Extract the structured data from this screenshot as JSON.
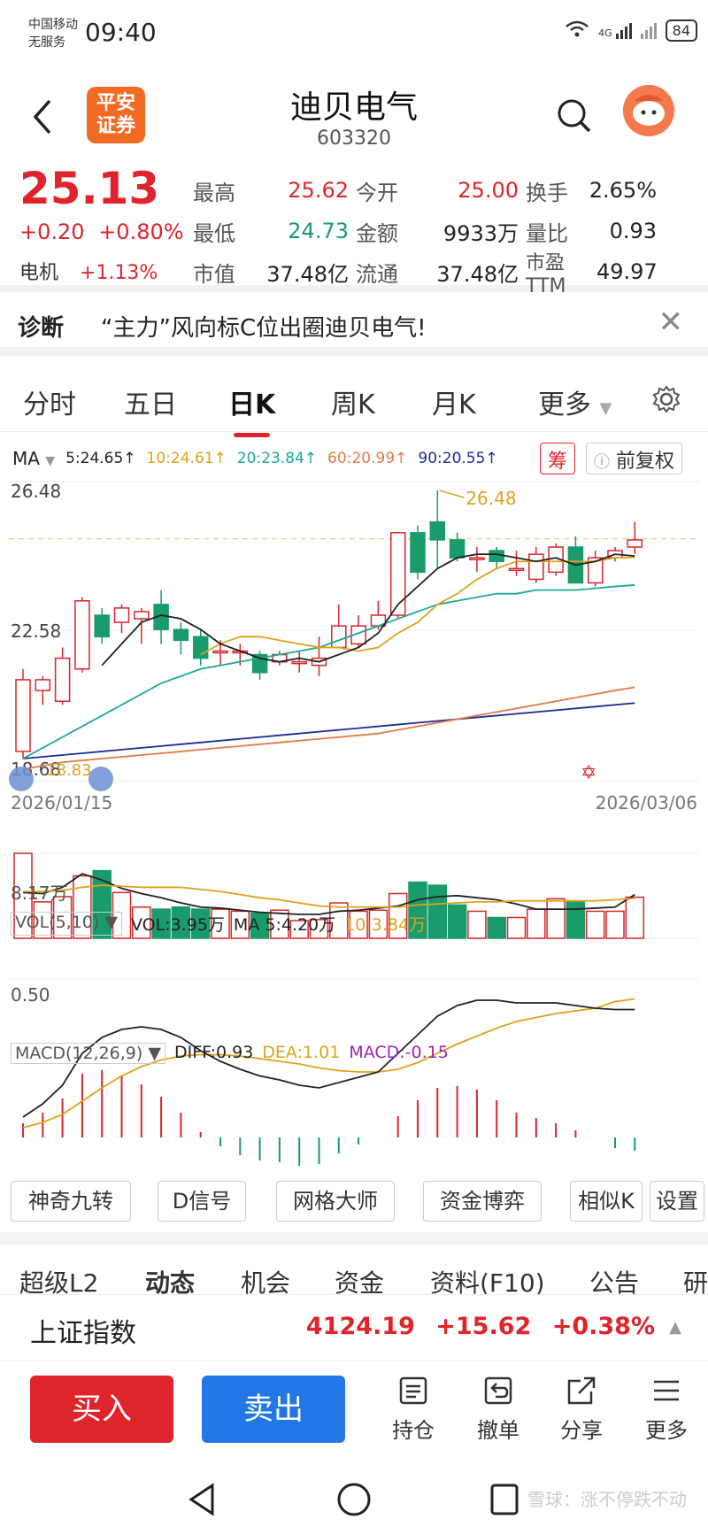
{
  "status": {
    "carrier1": "中国移动",
    "carrier2": "无服务",
    "time": "09:40",
    "network": "4G",
    "battery": "84"
  },
  "header": {
    "logo_line1": "平安",
    "logo_line2": "证券",
    "title": "迪贝电气",
    "code": "603320"
  },
  "quote": {
    "price": "25.13",
    "change": "+0.20",
    "change_pct": "+0.80%",
    "sector_name": "电机",
    "sector_pct": "+1.13%",
    "rows": [
      [
        {
          "l": "最高",
          "v": "25.62",
          "c": "red"
        },
        {
          "l": "今开",
          "v": "25.00",
          "c": "red"
        },
        {
          "l": "换手",
          "v": "2.65%",
          "c": ""
        }
      ],
      [
        {
          "l": "最低",
          "v": "24.73",
          "c": "green"
        },
        {
          "l": "金额",
          "v": "9933万",
          "c": ""
        },
        {
          "l": "量比",
          "v": "0.93",
          "c": ""
        }
      ],
      [
        {
          "l": "市值",
          "v": "37.48亿",
          "c": ""
        },
        {
          "l": "流通",
          "v": "37.48亿",
          "c": ""
        },
        {
          "l": "市盈TTM",
          "v": "49.97",
          "c": ""
        }
      ]
    ]
  },
  "diagnosis": {
    "label": "诊断",
    "text": "“主力”风向标C位出圈迪贝电气!"
  },
  "tabs": [
    "分时",
    "五日",
    "日K",
    "周K",
    "月K",
    "更多"
  ],
  "ma_legend": {
    "label": "MA",
    "ma5": "5:24.65↑",
    "ma10": "10:24.61↑",
    "ma20": "20:23.84↑",
    "ma60": "60:20.99↑",
    "ma90": "90:20.55↑",
    "chip": "筹",
    "fq": "前复权"
  },
  "axis": {
    "top": "26.48",
    "mid": "22.58",
    "low": "18.68",
    "low_annot": "18.83",
    "high_annot": "26.48",
    "date_start": "2026/01/15",
    "date_end": "2026/03/06"
  },
  "vol_legend": {
    "label": "VOL(5,10)",
    "vol": "VOL:3.95万",
    "ma5": "MA 5:4.20万",
    "ma10": "10:3.84万",
    "axis_label": "8.17万"
  },
  "macd_legend": {
    "label": "MACD(12,26,9)",
    "diff": "DIFF:0.93",
    "dea": "DEA:1.01",
    "macd": "MACD:-0.15",
    "axis_label": "0.50"
  },
  "tools": [
    "神奇九转",
    "D信号",
    "网格大师",
    "资金博弈",
    "相似K",
    "设置"
  ],
  "subtabs": [
    "超级L2",
    "动态",
    "机会",
    "资金",
    "资料(F10)",
    "公告",
    "研"
  ],
  "index": {
    "name": "上证指数",
    "value": "4124.19",
    "change": "+15.62",
    "pct": "+0.38%"
  },
  "actions": {
    "buy": "买入",
    "sell": "卖出",
    "hold": "持仓",
    "cancel": "撤单",
    "share": "分享",
    "more": "更多"
  },
  "watermark": "雪球：涨不停跌不动",
  "chart_data": {
    "type": "candlestick",
    "x": [
      "2026/01/15",
      "2026/03/06"
    ],
    "ylim": [
      18.68,
      26.48
    ],
    "candles": [
      [
        19.2,
        21.2,
        19.0,
        21.5
      ],
      [
        20.9,
        21.2,
        20.5,
        21.3
      ],
      [
        20.6,
        21.8,
        20.5,
        22.1
      ],
      [
        21.5,
        23.4,
        21.4,
        23.5
      ],
      [
        23.0,
        22.4,
        22.2,
        23.2
      ],
      [
        22.8,
        23.2,
        22.5,
        23.3
      ],
      [
        22.9,
        23.1,
        22.2,
        23.2
      ],
      [
        23.3,
        22.6,
        22.2,
        23.7
      ],
      [
        22.6,
        22.3,
        21.9,
        22.8
      ],
      [
        22.4,
        21.8,
        21.6,
        22.6
      ],
      [
        22.0,
        22.0,
        21.6,
        22.3
      ],
      [
        22.0,
        22.0,
        21.6,
        22.2
      ],
      [
        21.9,
        21.4,
        21.2,
        22.0
      ],
      [
        21.7,
        21.9,
        21.6,
        22.0
      ],
      [
        21.7,
        21.7,
        21.4,
        22.0
      ],
      [
        21.6,
        21.8,
        21.3,
        22.4
      ],
      [
        22.1,
        22.7,
        22.1,
        23.3
      ],
      [
        22.2,
        22.7,
        22.1,
        23.0
      ],
      [
        22.7,
        23.0,
        22.6,
        23.4
      ],
      [
        23.0,
        25.3,
        22.9,
        25.3
      ],
      [
        25.3,
        24.2,
        24.0,
        25.5
      ],
      [
        25.6,
        25.1,
        24.3,
        26.48
      ],
      [
        25.1,
        24.6,
        24.5,
        25.3
      ],
      [
        24.6,
        24.6,
        24.2,
        24.9
      ],
      [
        24.8,
        24.5,
        24.3,
        24.9
      ],
      [
        24.3,
        24.3,
        24.1,
        24.8
      ],
      [
        24.0,
        24.7,
        23.9,
        24.9
      ],
      [
        24.2,
        24.9,
        24.1,
        25.0
      ],
      [
        24.9,
        23.9,
        23.9,
        25.2
      ],
      [
        23.9,
        24.6,
        23.8,
        24.8
      ],
      [
        24.6,
        24.8,
        24.5,
        24.9
      ],
      [
        24.9,
        25.1,
        24.7,
        25.6
      ]
    ],
    "ma5": [
      null,
      null,
      null,
      null,
      21.6,
      22.2,
      22.8,
      23.0,
      22.9,
      22.6,
      22.2,
      22.0,
      21.8,
      21.7,
      21.8,
      21.7,
      21.9,
      22.1,
      22.5,
      23.3,
      23.8,
      24.3,
      24.6,
      24.7,
      24.7,
      24.6,
      24.5,
      24.6,
      24.4,
      24.5,
      24.7,
      24.65
    ],
    "ma10": [
      null,
      null,
      null,
      null,
      null,
      null,
      null,
      null,
      null,
      21.9,
      22.2,
      22.4,
      22.4,
      22.3,
      22.2,
      22.1,
      22.1,
      22.0,
      22.1,
      22.5,
      22.8,
      23.3,
      23.6,
      24.0,
      24.3,
      24.5,
      24.5,
      24.5,
      24.5,
      24.5,
      24.6,
      24.61
    ],
    "ma20": [
      19.0,
      19.3,
      19.6,
      19.9,
      20.2,
      20.5,
      20.8,
      21.1,
      21.3,
      21.5,
      21.6,
      21.7,
      21.8,
      21.9,
      22.0,
      22.1,
      22.3,
      22.5,
      22.7,
      22.9,
      23.1,
      23.3,
      23.4,
      23.5,
      23.6,
      23.6,
      23.7,
      23.7,
      23.7,
      23.75,
      23.8,
      23.84
    ],
    "ma60": [
      18.7,
      18.8,
      18.9,
      18.95,
      19.0,
      19.05,
      19.1,
      19.15,
      19.2,
      19.25,
      19.3,
      19.35,
      19.4,
      19.45,
      19.5,
      19.55,
      19.6,
      19.65,
      19.7,
      19.8,
      19.9,
      20.0,
      20.1,
      20.2,
      20.3,
      20.4,
      20.5,
      20.6,
      20.7,
      20.8,
      20.9,
      20.99
    ],
    "ma90": [
      19.0,
      19.05,
      19.1,
      19.15,
      19.2,
      19.25,
      19.3,
      19.35,
      19.4,
      19.45,
      19.5,
      19.55,
      19.6,
      19.65,
      19.7,
      19.75,
      19.8,
      19.85,
      19.9,
      19.95,
      20.0,
      20.05,
      20.1,
      20.15,
      20.2,
      20.25,
      20.3,
      20.35,
      20.4,
      20.45,
      20.5,
      20.55
    ],
    "volume": [
      8.17,
      3.5,
      4.0,
      6.0,
      6.5,
      4.4,
      3.0,
      2.8,
      3.0,
      2.8,
      2.8,
      2.6,
      2.4,
      2.7,
      1.7,
      1.8,
      3.4,
      2.6,
      2.7,
      4.3,
      5.4,
      5.1,
      3.2,
      2.6,
      2.0,
      2.0,
      2.8,
      3.8,
      3.5,
      2.6,
      2.6,
      3.95
    ],
    "vol_ma5": [
      4.4,
      4.3,
      4.9,
      6.2,
      5.6,
      4.8,
      4.3,
      3.9,
      3.4,
      3.0,
      2.9,
      2.7,
      2.5,
      2.4,
      2.3,
      2.3,
      2.6,
      2.7,
      2.9,
      3.1,
      3.7,
      4.0,
      4.1,
      3.9,
      3.7,
      3.3,
      2.8,
      2.8,
      2.8,
      2.9,
      3.0,
      4.2
    ],
    "vol_ma10": [
      4.5,
      4.5,
      4.6,
      4.9,
      5.1,
      5.0,
      4.9,
      4.9,
      4.9,
      4.7,
      4.5,
      4.2,
      3.9,
      3.7,
      3.4,
      3.1,
      3.0,
      3.0,
      3.0,
      3.0,
      3.2,
      3.3,
      3.4,
      3.5,
      3.5,
      3.6,
      3.6,
      3.6,
      3.6,
      3.6,
      3.7,
      3.84
    ],
    "diff": [
      0.12,
      0.22,
      0.36,
      0.6,
      0.72,
      0.78,
      0.8,
      0.78,
      0.72,
      0.62,
      0.54,
      0.48,
      0.43,
      0.4,
      0.36,
      0.34,
      0.38,
      0.42,
      0.46,
      0.6,
      0.74,
      0.88,
      0.96,
      1.0,
      1.0,
      0.98,
      0.98,
      0.98,
      0.96,
      0.94,
      0.93,
      0.93
    ],
    "dea": [
      0.04,
      0.08,
      0.14,
      0.24,
      0.34,
      0.43,
      0.5,
      0.55,
      0.58,
      0.59,
      0.59,
      0.58,
      0.56,
      0.54,
      0.52,
      0.49,
      0.47,
      0.46,
      0.46,
      0.48,
      0.53,
      0.6,
      0.67,
      0.73,
      0.79,
      0.84,
      0.87,
      0.9,
      0.92,
      0.94,
      0.99,
      1.01
    ],
    "macd": [
      0.16,
      0.28,
      0.44,
      0.72,
      0.76,
      0.7,
      0.6,
      0.46,
      0.28,
      0.06,
      -0.1,
      -0.2,
      -0.26,
      -0.28,
      -0.32,
      -0.3,
      -0.18,
      -0.08,
      0.0,
      0.24,
      0.42,
      0.56,
      0.58,
      0.54,
      0.42,
      0.28,
      0.22,
      0.16,
      0.08,
      0.0,
      -0.12,
      -0.15
    ]
  }
}
